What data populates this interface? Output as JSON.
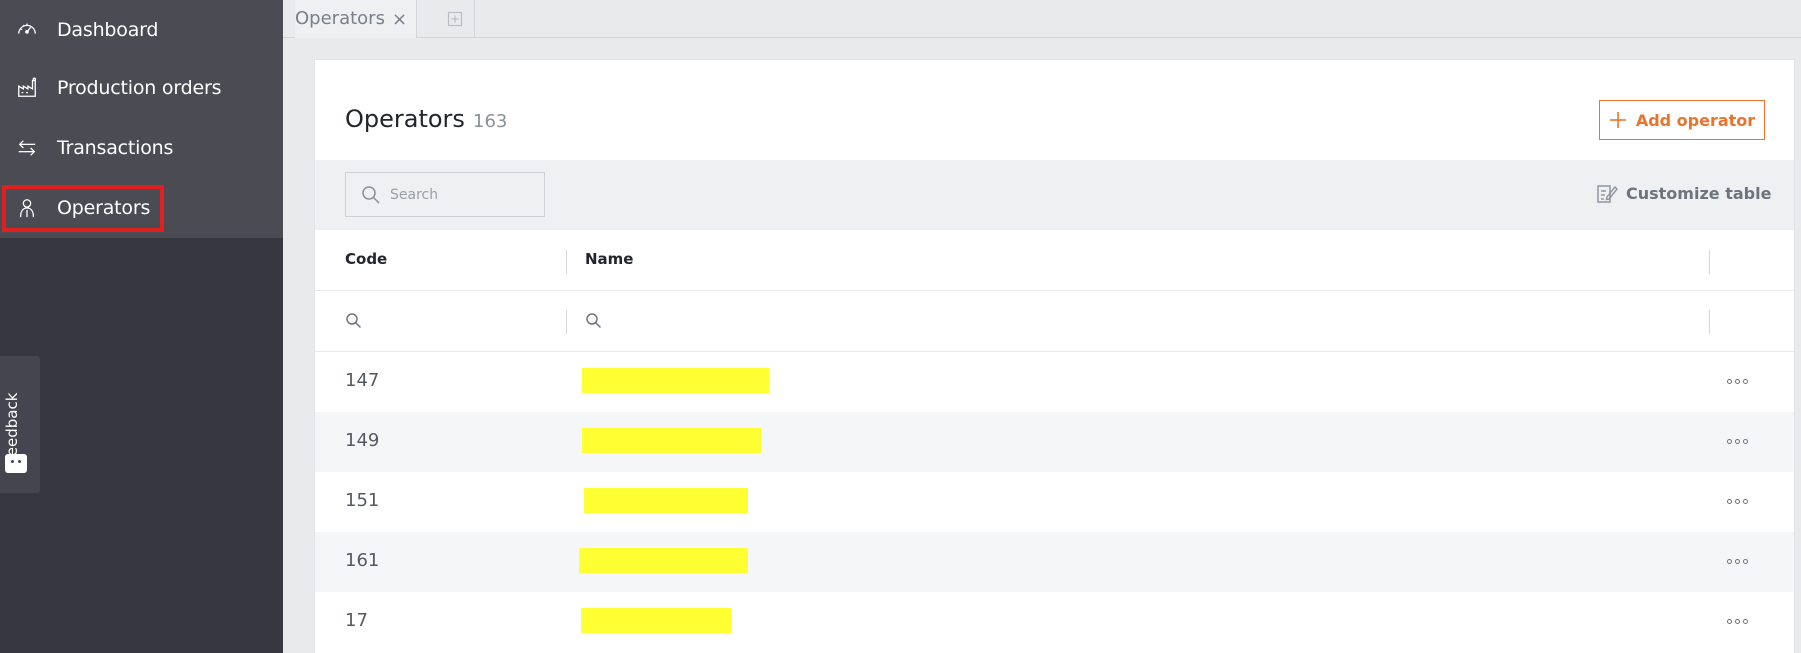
{
  "sidebar": {
    "items": [
      {
        "label": "Dashboard",
        "icon": "gauge-icon"
      },
      {
        "label": "Production orders",
        "icon": "factory-icon"
      },
      {
        "label": "Transactions",
        "icon": "arrows-exchange-icon"
      },
      {
        "label": "Operators",
        "icon": "person-icon"
      }
    ],
    "feedback_label": "Feedback"
  },
  "tabs": [
    {
      "label": "Operators",
      "close": "×"
    }
  ],
  "page": {
    "title": "Operators",
    "count": "163",
    "add_button_label": "Add operator",
    "search_placeholder": "Search",
    "customize_label": "Customize table"
  },
  "table": {
    "columns": [
      "Code",
      "Name"
    ],
    "rows": [
      {
        "code": "147",
        "name": ""
      },
      {
        "code": "149",
        "name": ""
      },
      {
        "code": "151",
        "name": ""
      },
      {
        "code": "161",
        "name": ""
      },
      {
        "code": "17",
        "name": ""
      }
    ]
  },
  "colors": {
    "accent": "#e8742d",
    "sidebar_bg": "#363741",
    "highlight": "#e02020",
    "redaction": "#ffff33"
  }
}
